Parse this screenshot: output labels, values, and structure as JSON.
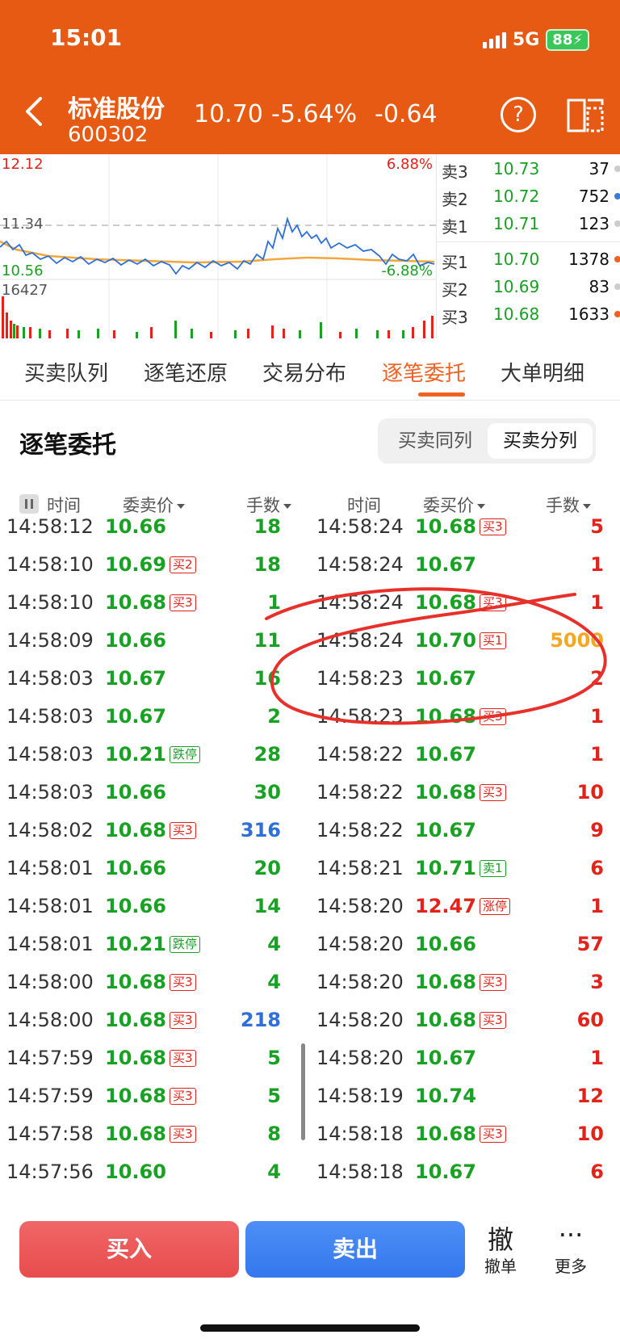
{
  "status_bar": {
    "time": "15:01",
    "network": "5G",
    "battery": "88"
  },
  "header": {
    "stock_name": "标准股份",
    "stock_code": "600302",
    "price": "10.70",
    "change_pct": "-5.64%",
    "change": "-0.64"
  },
  "chart": {
    "high": "12.12",
    "high_pct": "6.88%",
    "mid": "11.34",
    "low": "10.56",
    "low_pct": "-6.88%",
    "volume": "16427"
  },
  "order_book": {
    "asks": [
      {
        "label": "卖3",
        "price": "10.73",
        "qty": "37",
        "dot": "#cccccc"
      },
      {
        "label": "卖2",
        "price": "10.72",
        "qty": "752",
        "dot": "#3a7bd5"
      },
      {
        "label": "卖1",
        "price": "10.71",
        "qty": "123",
        "dot": "#cccccc"
      }
    ],
    "bids": [
      {
        "label": "买1",
        "price": "10.70",
        "qty": "1378",
        "dot": "#ef6222"
      },
      {
        "label": "买2",
        "price": "10.69",
        "qty": "83",
        "dot": "#cccccc"
      },
      {
        "label": "买3",
        "price": "10.68",
        "qty": "1633",
        "dot": "#ef6222"
      }
    ]
  },
  "tabs": [
    {
      "label": "买卖队列"
    },
    {
      "label": "逐笔还原"
    },
    {
      "label": "交易分布"
    },
    {
      "label": "逐笔委托",
      "active": true
    },
    {
      "label": "大单明细"
    }
  ],
  "section": {
    "title": "逐笔委托",
    "seg_same": "买卖同列",
    "seg_split": "买卖分列"
  },
  "columns": {
    "left": {
      "time": "时间",
      "price": "委卖价",
      "qty": "手数"
    },
    "right": {
      "time": "时间",
      "price": "委买价",
      "qty": "手数"
    }
  },
  "sell_rows": [
    {
      "time": "14:58:12",
      "price": "10.66",
      "badge": "",
      "qty": "18"
    },
    {
      "time": "14:58:10",
      "price": "10.69",
      "badge": "买2",
      "qty": "18"
    },
    {
      "time": "14:58:10",
      "price": "10.68",
      "badge": "买3",
      "qty": "1"
    },
    {
      "time": "14:58:09",
      "price": "10.66",
      "badge": "",
      "qty": "11"
    },
    {
      "time": "14:58:03",
      "price": "10.67",
      "badge": "",
      "qty": "16"
    },
    {
      "time": "14:58:03",
      "price": "10.67",
      "badge": "",
      "qty": "2"
    },
    {
      "time": "14:58:03",
      "price": "10.21",
      "badge": "跌停",
      "qty": "28"
    },
    {
      "time": "14:58:03",
      "price": "10.66",
      "badge": "",
      "qty": "30"
    },
    {
      "time": "14:58:02",
      "price": "10.68",
      "badge": "买3",
      "qty": "316",
      "qty_color": "#2f6fd8"
    },
    {
      "time": "14:58:01",
      "price": "10.66",
      "badge": "",
      "qty": "20"
    },
    {
      "time": "14:58:01",
      "price": "10.66",
      "badge": "",
      "qty": "14"
    },
    {
      "time": "14:58:01",
      "price": "10.21",
      "badge": "跌停",
      "qty": "4"
    },
    {
      "time": "14:58:00",
      "price": "10.68",
      "badge": "买3",
      "qty": "4"
    },
    {
      "time": "14:58:00",
      "price": "10.68",
      "badge": "买3",
      "qty": "218",
      "qty_color": "#2f6fd8"
    },
    {
      "time": "14:57:59",
      "price": "10.68",
      "badge": "买3",
      "qty": "5"
    },
    {
      "time": "14:57:59",
      "price": "10.68",
      "badge": "买3",
      "qty": "5"
    },
    {
      "time": "14:57:58",
      "price": "10.68",
      "badge": "买3",
      "qty": "8"
    },
    {
      "time": "14:57:56",
      "price": "10.60",
      "badge": "",
      "qty": "4"
    }
  ],
  "buy_rows": [
    {
      "time": "14:58:24",
      "price": "10.68",
      "badge": "买3",
      "qty": "5"
    },
    {
      "time": "14:58:24",
      "price": "10.67",
      "badge": "",
      "qty": "1"
    },
    {
      "time": "14:58:24",
      "price": "10.68",
      "badge": "买3",
      "qty": "1"
    },
    {
      "time": "14:58:24",
      "price": "10.70",
      "badge": "买1",
      "qty": "5000",
      "qty_color": "#f5a623"
    },
    {
      "time": "14:58:23",
      "price": "10.67",
      "badge": "",
      "qty": "2"
    },
    {
      "time": "14:58:23",
      "price": "10.68",
      "badge": "买3",
      "qty": "1"
    },
    {
      "time": "14:58:22",
      "price": "10.67",
      "badge": "",
      "qty": "1"
    },
    {
      "time": "14:58:22",
      "price": "10.68",
      "badge": "买3",
      "qty": "10"
    },
    {
      "time": "14:58:22",
      "price": "10.67",
      "badge": "",
      "qty": "9"
    },
    {
      "time": "14:58:21",
      "price": "10.71",
      "badge": "卖1",
      "qty": "6"
    },
    {
      "time": "14:58:20",
      "price": "12.47",
      "badge": "涨停",
      "qty": "1",
      "price_color": "#e2231a"
    },
    {
      "time": "14:58:20",
      "price": "10.66",
      "badge": "",
      "qty": "57"
    },
    {
      "time": "14:58:20",
      "price": "10.68",
      "badge": "买3",
      "qty": "3"
    },
    {
      "time": "14:58:20",
      "price": "10.68",
      "badge": "买3",
      "qty": "60"
    },
    {
      "time": "14:58:20",
      "price": "10.67",
      "badge": "",
      "qty": "1"
    },
    {
      "time": "14:58:19",
      "price": "10.74",
      "badge": "",
      "qty": "12"
    },
    {
      "time": "14:58:18",
      "price": "10.68",
      "badge": "买3",
      "qty": "10"
    },
    {
      "time": "14:58:18",
      "price": "10.67",
      "badge": "",
      "qty": "6"
    }
  ],
  "bottom": {
    "buy": "买入",
    "sell": "卖出",
    "cancel_big": "撤",
    "cancel": "撤单",
    "more_big": "···",
    "more": "更多"
  },
  "colors": {
    "header": "#e65a14",
    "up": "#e2231a",
    "down": "#19a124",
    "accent": "#ef6222",
    "annotation": "#e8302a"
  },
  "icons": [
    "back-arrow-icon",
    "help-icon",
    "switch-screen-icon",
    "pause-icon"
  ]
}
